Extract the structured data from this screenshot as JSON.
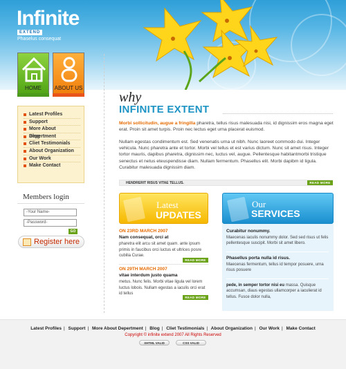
{
  "brand": {
    "logo": "Infinite",
    "sublogo": "EXTEND",
    "tagline": "Phaselus consequat"
  },
  "nav": {
    "home": "HOME",
    "about": "ABOUT US"
  },
  "menu": [
    "Latest Profiles",
    "Support",
    "More About Depertment",
    "Blog",
    "Cliet Testimonials",
    "About Organization",
    "Our Work",
    "Make Contact"
  ],
  "login": {
    "title": "Members login",
    "name_placeholder": "-Your Name-",
    "password_placeholder": "-Password-",
    "go": "GO",
    "register": "Register here"
  },
  "main": {
    "why": "why",
    "title": "INFINITE EXTENT",
    "intro_highlight": "Morbi sollicitudin, augue a fringilla",
    "intro_rest": " pharetra, tellus risus malesuada nisi, id dignissim eros magna eget erat. Proin sit amet turpis. Proin nec lectus eget urna placerat euismod.",
    "para2": "Nullam egestas condimentum est. Sed venenatis urna ut nibh. Nunc laoreet commodo dui. Integer vehicula. Nunc pharetra ante et tortor. Morbi vel tellus et est varius dictum. Nunc sit amet risus. Integer tortor mauris, dapibus pharetra, dignissim nec, luctus vel, augue. Pellentesque habitantmorbi tristique senectus et netus eteuspendisse diam. Nullam fermentum. Phasellus elit. Morbi dapibm id ligula. Curabitur malesuada dignissim diam.",
    "strip": "HENDRERIT RISUS VITAE TELLUS.",
    "read_more": "READ MORE"
  },
  "updates": {
    "head_small": "Latest",
    "head_big": "UPDATES",
    "items": [
      {
        "date": "ON 23RD MARCH 2007",
        "title": "Nam consequat, orci at",
        "text": "pharetra elit arcu sit amet quam. ante ipsum primis in faucibus orci luctus et ultrices posre cubilia Curae."
      },
      {
        "date": "ON 29TH MARCH 2007",
        "title": "vitae interdum justo quama",
        "text": "metus. Nunc felis. Morbi vitae ligula vel lorem luctus lobois. Nullam egestas a iaculis orci erat id tellus"
      }
    ]
  },
  "services": {
    "head_small": "Our",
    "head_big": "SERVICES",
    "items": [
      {
        "title": "Curabitur nonummy.",
        "text": "Maecenas iaculis nonummy dolor. Sed sed risus ut felis pellentesque suscipit. Morbi sit amet libero."
      },
      {
        "title": "Phasellus porta nulla id risus.",
        "text": "Maecenas fermentum, tellus id tempor posuere, urna risus posuere"
      },
      {
        "title": "pede, in semper tortor nisi eu",
        "text": " massa. Quisque accumsan, diaus egestas ullamcorper a iaculierat id tellus. Fusce dolor nulla,"
      }
    ]
  },
  "footer": {
    "links": [
      "Latest Profiles",
      "Support",
      "More About Depertment",
      "Blog",
      "Cliet Testimonials",
      "About Organization",
      "Our Work",
      "Make Contact"
    ],
    "copyright": "Copyright © infinite extend 2007 All Rights Reserved",
    "xhtml": "XHTML VALID",
    "css": "CSS VALID"
  },
  "colors": {
    "accent_blue": "#1e94c5",
    "accent_orange": "#e56a00",
    "green": "#6aa218",
    "yellow": "#f6b800"
  }
}
